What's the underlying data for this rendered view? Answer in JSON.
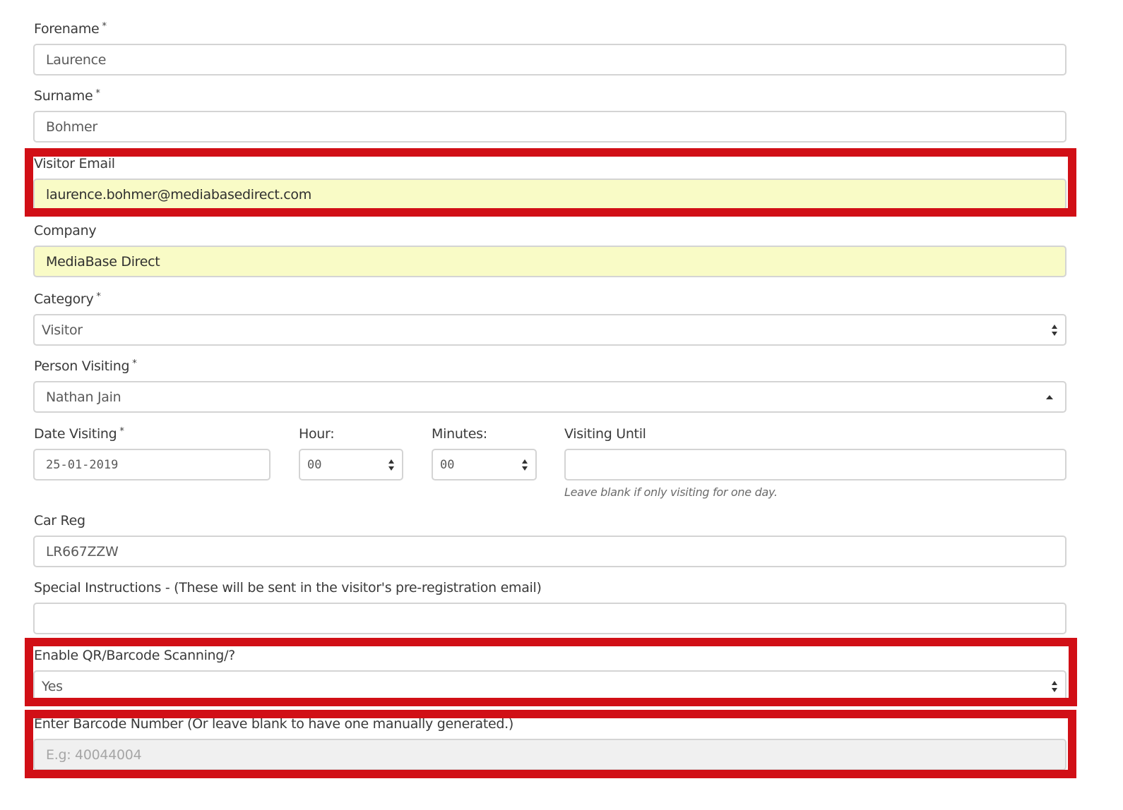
{
  "form": {
    "forename": {
      "label": "Forename",
      "required": "*",
      "value": "Laurence"
    },
    "surname": {
      "label": "Surname",
      "required": "*",
      "value": "Bohmer"
    },
    "visitor_email": {
      "label": "Visitor Email",
      "value": "laurence.bohmer@mediabasedirect.com"
    },
    "company": {
      "label": "Company",
      "value": "MediaBase Direct"
    },
    "category": {
      "label": "Category",
      "required": "*",
      "value": "Visitor"
    },
    "person_visiting": {
      "label": "Person Visiting",
      "required": "*",
      "value": "Nathan Jain"
    },
    "date_visiting": {
      "label": "Date Visiting",
      "required": "*",
      "value": "25-01-2019"
    },
    "hour": {
      "label": "Hour:",
      "value": "00"
    },
    "minutes": {
      "label": "Minutes:",
      "value": "00"
    },
    "visiting_until": {
      "label": "Visiting Until",
      "value": "",
      "help": "Leave blank if only visiting for one day."
    },
    "car_reg": {
      "label": "Car Reg",
      "value": "LR667ZZW"
    },
    "special_instructions": {
      "label": "Special Instructions - (These will be sent in the visitor's pre-registration email)",
      "value": ""
    },
    "enable_qr": {
      "label": "Enable QR/Barcode Scanning/?",
      "value": "Yes"
    },
    "barcode": {
      "label": "Enter Barcode Number (Or leave blank to have one manually generated.)",
      "placeholder": "E.g: 40044004"
    }
  },
  "colors": {
    "highlight": "#d10f16",
    "autofill": "#f9fbc6",
    "border": "#d4d4d4"
  },
  "icons": {
    "select_arrows": "updown-arrows-icon",
    "dropdown_caret": "caret-up-icon"
  }
}
